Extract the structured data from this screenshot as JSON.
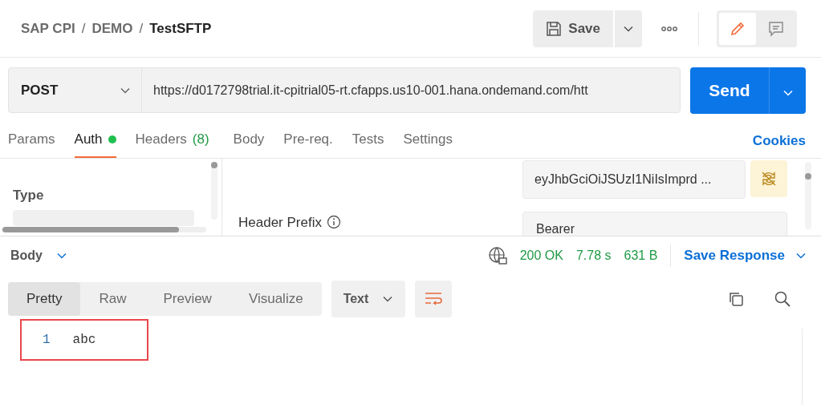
{
  "breadcrumb": {
    "path": [
      "SAP CPI",
      "DEMO"
    ],
    "separator": "/",
    "current": "TestSFTP"
  },
  "toolbar": {
    "save": "Save",
    "modes": [
      {
        "kind": "edit",
        "selected": true
      },
      {
        "kind": "comment",
        "selected": false
      }
    ]
  },
  "request": {
    "method": "POST",
    "url": "https://d0172798trial.it-cpitrial05-rt.cfapps.us10-001.hana.ondemand.com/htt",
    "send": "Send"
  },
  "tabs": [
    {
      "label": "Params",
      "selected": false
    },
    {
      "label": "Auth",
      "selected": true,
      "dot": true
    },
    {
      "label": "Headers",
      "selected": false,
      "count": "(8)"
    },
    {
      "label": "Body",
      "selected": false
    },
    {
      "label": "Pre-req.",
      "selected": false
    },
    {
      "label": "Tests",
      "selected": false
    },
    {
      "label": "Settings",
      "selected": false
    }
  ],
  "cookies": "Cookies",
  "auth": {
    "type_label": "Type",
    "token": "eyJhbGciOiJSUzI1NiIsImprd ...",
    "header_prefix_label": "Header Prefix",
    "header_prefix": "Bearer"
  },
  "response": {
    "section": "Body",
    "status": "200 OK",
    "time": "7.78 s",
    "size": "631 B",
    "save": "Save Response",
    "views": [
      {
        "label": "Pretty",
        "selected": true
      },
      {
        "label": "Raw",
        "selected": false
      },
      {
        "label": "Preview",
        "selected": false
      },
      {
        "label": "Visualize",
        "selected": false
      }
    ],
    "format": "Text",
    "wrap": true,
    "lines": [
      {
        "number": "1",
        "text": "abc",
        "highlighted": true
      }
    ]
  }
}
